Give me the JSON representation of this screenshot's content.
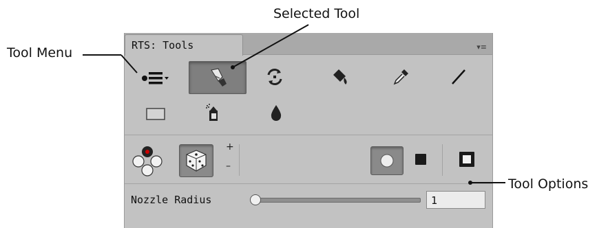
{
  "callouts": {
    "tool_menu": "Tool Menu",
    "selected_tool": "Selected Tool",
    "tool_options": "Tool Options"
  },
  "window": {
    "tab_title": "RTS: Tools",
    "tab_menu_icon": "panel-menu-icon"
  },
  "toolbar": {
    "row1": [
      "tool-menu-icon",
      "paint-brush-icon",
      "randomize-icon",
      "paint-bucket-icon",
      "eyedropper-icon",
      "line-icon"
    ],
    "row2": [
      "rectangle-icon",
      "spray-can-icon",
      "drop-icon"
    ],
    "selected": "paint-brush-icon"
  },
  "brush_controls": {
    "plus": "+",
    "minus": "–",
    "icons": [
      "brush-palette-icon",
      "dice-icon",
      "circle-shape-icon",
      "square-shape-icon",
      "outline-square-icon"
    ]
  },
  "options": {
    "nozzle_radius_label": "Nozzle Radius",
    "nozzle_radius_value": "1"
  },
  "colors": {
    "panel": "#c2c2c2",
    "selected": "#7f7f7f"
  }
}
